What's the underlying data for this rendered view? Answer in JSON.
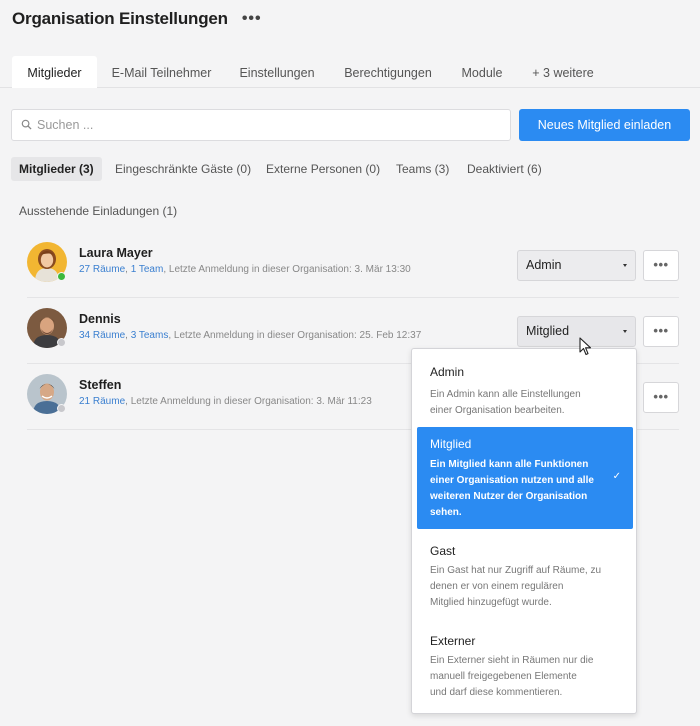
{
  "header": {
    "title": "Organisation Einstellungen",
    "more_label": "•••"
  },
  "tabs": [
    {
      "label": "Mitglieder"
    },
    {
      "label": "E-Mail Teilnehmer"
    },
    {
      "label": "Einstellungen"
    },
    {
      "label": "Berechtigungen"
    },
    {
      "label": "Module"
    },
    {
      "label": "+ 3 weitere"
    }
  ],
  "search": {
    "placeholder": "Suchen ...",
    "value": ""
  },
  "invite_button": {
    "label": "Neues Mitglied einladen"
  },
  "subtabs": [
    {
      "label": "Mitglieder (3)"
    },
    {
      "label": "Eingeschränkte Gäste (0)"
    },
    {
      "label": "Externe Personen (0)"
    },
    {
      "label": "Teams (3)"
    },
    {
      "label": "Deaktiviert (6)"
    }
  ],
  "pending_invitations": "Ausstehende Einladungen (1)",
  "members": [
    {
      "name": "Laura Mayer",
      "rooms": "27 Räume",
      "sep": ", ",
      "teams": "1 Team",
      "last_login": ", Letzte Anmeldung in dieser Organisation: 3. Mär 13:30",
      "role": "Admin",
      "status": "online",
      "status_color": "#3cb83c"
    },
    {
      "name": "Dennis",
      "rooms": "34 Räume",
      "sep": ", ",
      "teams": "3 Teams",
      "last_login": ", Letzte Anmeldung in dieser Organisation: 25. Feb 12:37",
      "role": "Mitglied",
      "status": "offline",
      "status_color": "#c8c8cc"
    },
    {
      "name": "Steffen",
      "rooms": "21 Räume",
      "sep": "",
      "teams": "",
      "last_login": ", Letzte Anmeldung in dieser Organisation: 3. Mär 11:23",
      "role": "",
      "status": "offline",
      "status_color": "#c8c8cc"
    }
  ],
  "more_button_label": "•••",
  "role_dropdown": {
    "selected": "Mitglied",
    "options": [
      {
        "title": "Admin",
        "desc": [
          "Ein Admin kann alle Einstellungen",
          "einer Organisation bearbeiten."
        ]
      },
      {
        "title": "Mitglied",
        "desc": [
          "Ein Mitglied kann alle Funktionen",
          "einer Organisation nutzen und alle",
          "weiteren Nutzer der Organisation",
          "sehen."
        ]
      },
      {
        "title": "Gast",
        "desc": [
          "Ein Gast hat nur Zugriff auf Räume, zu",
          "denen er von einem regulären",
          "Mitglied hinzugefügt wurde."
        ]
      },
      {
        "title": "Externer",
        "desc": [
          "Ein Externer sieht in Räumen nur die",
          "manuell freigegebenen Elemente",
          "und darf diese kommentieren."
        ]
      }
    ],
    "check_icon": "check-icon"
  },
  "colors": {
    "accent": "#2b8bf2",
    "link": "#3a7fd0",
    "background": "#f4f4f5"
  }
}
